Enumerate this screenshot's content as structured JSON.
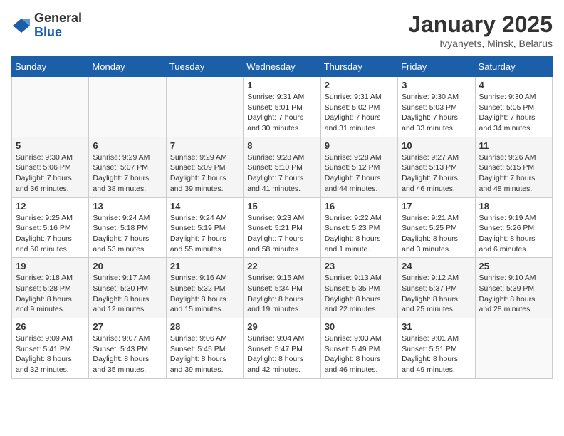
{
  "header": {
    "logo_general": "General",
    "logo_blue": "Blue",
    "month": "January 2025",
    "location": "Ivyanyets, Minsk, Belarus"
  },
  "weekdays": [
    "Sunday",
    "Monday",
    "Tuesday",
    "Wednesday",
    "Thursday",
    "Friday",
    "Saturday"
  ],
  "weeks": [
    [
      {
        "day": "",
        "info": ""
      },
      {
        "day": "",
        "info": ""
      },
      {
        "day": "",
        "info": ""
      },
      {
        "day": "1",
        "info": "Sunrise: 9:31 AM\nSunset: 5:01 PM\nDaylight: 7 hours\nand 30 minutes."
      },
      {
        "day": "2",
        "info": "Sunrise: 9:31 AM\nSunset: 5:02 PM\nDaylight: 7 hours\nand 31 minutes."
      },
      {
        "day": "3",
        "info": "Sunrise: 9:30 AM\nSunset: 5:03 PM\nDaylight: 7 hours\nand 33 minutes."
      },
      {
        "day": "4",
        "info": "Sunrise: 9:30 AM\nSunset: 5:05 PM\nDaylight: 7 hours\nand 34 minutes."
      }
    ],
    [
      {
        "day": "5",
        "info": "Sunrise: 9:30 AM\nSunset: 5:06 PM\nDaylight: 7 hours\nand 36 minutes."
      },
      {
        "day": "6",
        "info": "Sunrise: 9:29 AM\nSunset: 5:07 PM\nDaylight: 7 hours\nand 38 minutes."
      },
      {
        "day": "7",
        "info": "Sunrise: 9:29 AM\nSunset: 5:09 PM\nDaylight: 7 hours\nand 39 minutes."
      },
      {
        "day": "8",
        "info": "Sunrise: 9:28 AM\nSunset: 5:10 PM\nDaylight: 7 hours\nand 41 minutes."
      },
      {
        "day": "9",
        "info": "Sunrise: 9:28 AM\nSunset: 5:12 PM\nDaylight: 7 hours\nand 44 minutes."
      },
      {
        "day": "10",
        "info": "Sunrise: 9:27 AM\nSunset: 5:13 PM\nDaylight: 7 hours\nand 46 minutes."
      },
      {
        "day": "11",
        "info": "Sunrise: 9:26 AM\nSunset: 5:15 PM\nDaylight: 7 hours\nand 48 minutes."
      }
    ],
    [
      {
        "day": "12",
        "info": "Sunrise: 9:25 AM\nSunset: 5:16 PM\nDaylight: 7 hours\nand 50 minutes."
      },
      {
        "day": "13",
        "info": "Sunrise: 9:24 AM\nSunset: 5:18 PM\nDaylight: 7 hours\nand 53 minutes."
      },
      {
        "day": "14",
        "info": "Sunrise: 9:24 AM\nSunset: 5:19 PM\nDaylight: 7 hours\nand 55 minutes."
      },
      {
        "day": "15",
        "info": "Sunrise: 9:23 AM\nSunset: 5:21 PM\nDaylight: 7 hours\nand 58 minutes."
      },
      {
        "day": "16",
        "info": "Sunrise: 9:22 AM\nSunset: 5:23 PM\nDaylight: 8 hours\nand 1 minute."
      },
      {
        "day": "17",
        "info": "Sunrise: 9:21 AM\nSunset: 5:25 PM\nDaylight: 8 hours\nand 3 minutes."
      },
      {
        "day": "18",
        "info": "Sunrise: 9:19 AM\nSunset: 5:26 PM\nDaylight: 8 hours\nand 6 minutes."
      }
    ],
    [
      {
        "day": "19",
        "info": "Sunrise: 9:18 AM\nSunset: 5:28 PM\nDaylight: 8 hours\nand 9 minutes."
      },
      {
        "day": "20",
        "info": "Sunrise: 9:17 AM\nSunset: 5:30 PM\nDaylight: 8 hours\nand 12 minutes."
      },
      {
        "day": "21",
        "info": "Sunrise: 9:16 AM\nSunset: 5:32 PM\nDaylight: 8 hours\nand 15 minutes."
      },
      {
        "day": "22",
        "info": "Sunrise: 9:15 AM\nSunset: 5:34 PM\nDaylight: 8 hours\nand 19 minutes."
      },
      {
        "day": "23",
        "info": "Sunrise: 9:13 AM\nSunset: 5:35 PM\nDaylight: 8 hours\nand 22 minutes."
      },
      {
        "day": "24",
        "info": "Sunrise: 9:12 AM\nSunset: 5:37 PM\nDaylight: 8 hours\nand 25 minutes."
      },
      {
        "day": "25",
        "info": "Sunrise: 9:10 AM\nSunset: 5:39 PM\nDaylight: 8 hours\nand 28 minutes."
      }
    ],
    [
      {
        "day": "26",
        "info": "Sunrise: 9:09 AM\nSunset: 5:41 PM\nDaylight: 8 hours\nand 32 minutes."
      },
      {
        "day": "27",
        "info": "Sunrise: 9:07 AM\nSunset: 5:43 PM\nDaylight: 8 hours\nand 35 minutes."
      },
      {
        "day": "28",
        "info": "Sunrise: 9:06 AM\nSunset: 5:45 PM\nDaylight: 8 hours\nand 39 minutes."
      },
      {
        "day": "29",
        "info": "Sunrise: 9:04 AM\nSunset: 5:47 PM\nDaylight: 8 hours\nand 42 minutes."
      },
      {
        "day": "30",
        "info": "Sunrise: 9:03 AM\nSunset: 5:49 PM\nDaylight: 8 hours\nand 46 minutes."
      },
      {
        "day": "31",
        "info": "Sunrise: 9:01 AM\nSunset: 5:51 PM\nDaylight: 8 hours\nand 49 minutes."
      },
      {
        "day": "",
        "info": ""
      }
    ]
  ]
}
